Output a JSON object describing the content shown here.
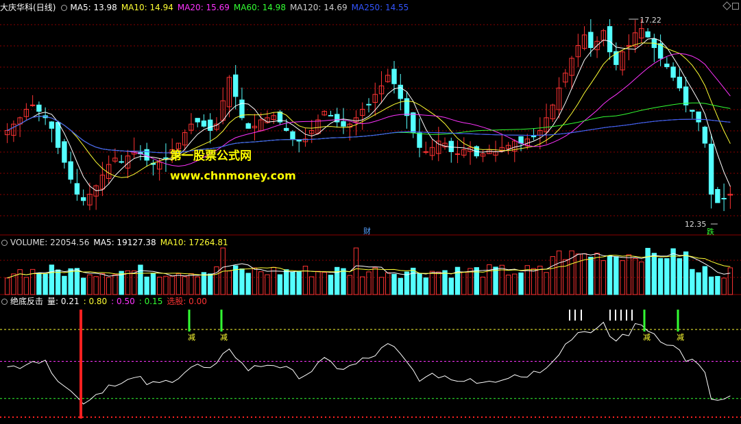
{
  "stock": {
    "name": "大庆华科",
    "period": "(日线)"
  },
  "main_legend": [
    {
      "label": "MA5: 13.98",
      "color": "#ffffff"
    },
    {
      "label": "MA10: 14.94",
      "color": "#ffff33"
    },
    {
      "label": "MA20: 15.69",
      "color": "#ff33ff"
    },
    {
      "label": "MA60: 14.98",
      "color": "#33ff33"
    },
    {
      "label": "MA120: 14.69",
      "color": "#cccccc"
    },
    {
      "label": "MA250: 14.55",
      "color": "#3355ff"
    }
  ],
  "volume_legend": [
    {
      "label": "VOLUME: 22054.56",
      "color": "#dddddd"
    },
    {
      "label": "MA5: 19127.38",
      "color": "#ffffff"
    },
    {
      "label": "MA10: 17264.81",
      "color": "#ffff33"
    }
  ],
  "indicator_legend": {
    "name": "绝底反击",
    "params": [
      {
        "label": "量: 0.21",
        "color": "#ffffff"
      },
      {
        "label": ": 0.80",
        "color": "#ffff33"
      },
      {
        "label": ": 0.50",
        "color": "#ff33ff"
      },
      {
        "label": ": 0.15",
        "color": "#33ff33"
      },
      {
        "label": "选股: 0.00",
        "color": "#ff3333"
      }
    ]
  },
  "watermark": {
    "line1": "第一股票公式网",
    "line2": "www.chnmoney.com"
  },
  "markers": {
    "high": "17.22",
    "low": "12.35",
    "cai": "财",
    "die": "跌",
    "jian": "减"
  },
  "colors": {
    "up": "#ff3333",
    "down": "#54ffff",
    "grid": "#8b0000",
    "bg": "#000000"
  },
  "chart_data": {
    "type": "candlestick",
    "price_high": 17.22,
    "price_low": 12.35,
    "indicator_levels": [
      0.8,
      0.5,
      0.15
    ],
    "close_series": [
      14.6,
      14.75,
      14.9,
      15.1,
      15.2,
      15.05,
      14.9,
      14.65,
      14.2,
      13.85,
      13.45,
      13.1,
      12.95,
      13.1,
      13.3,
      13.55,
      13.8,
      13.95,
      13.85,
      14.0,
      14.1,
      14.05,
      13.9,
      13.8,
      13.85,
      13.95,
      14.15,
      14.3,
      14.55,
      14.75,
      14.8,
      14.7,
      14.6,
      14.75,
      15.3,
      15.85,
      15.4,
      14.9,
      14.65,
      14.7,
      14.85,
      14.9,
      14.95,
      14.8,
      14.6,
      14.4,
      14.35,
      14.4,
      14.6,
      14.85,
      15.05,
      14.95,
      14.8,
      14.7,
      14.75,
      14.9,
      15.1,
      15.2,
      15.45,
      15.65,
      15.9,
      15.7,
      15.35,
      14.95,
      14.55,
      14.2,
      14.1,
      14.2,
      14.35,
      14.3,
      14.1,
      14.05,
      14.15,
      14.2,
      14.0,
      14.05,
      14.15,
      14.1,
      14.2,
      14.25,
      14.35,
      14.3,
      14.4,
      14.45,
      14.6,
      14.9,
      15.2,
      15.6,
      15.95,
      16.3,
      16.6,
      16.85,
      16.55,
      16.7,
      16.95,
      16.45,
      16.15,
      16.45,
      16.6,
      16.9,
      17.0,
      16.8,
      16.55,
      16.3,
      16.1,
      15.85,
      15.6,
      15.2,
      15.05,
      14.8,
      14.3,
      13.1,
      12.9,
      13.0,
      13.1
    ]
  }
}
